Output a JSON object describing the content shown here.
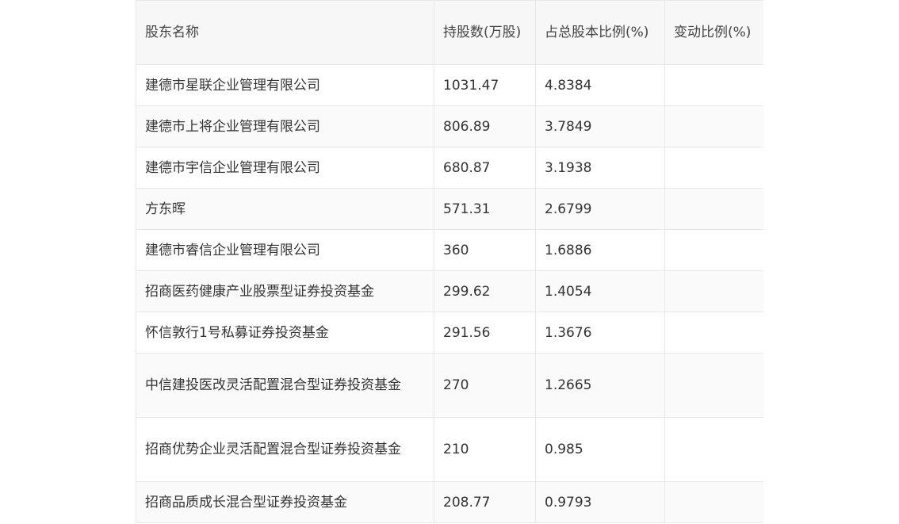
{
  "table": {
    "headers": [
      "股东名称",
      "持股数(万股)",
      "占总股本比例(%)",
      "变动比例(%)"
    ],
    "rows": [
      {
        "name": "建德市星联企业管理有限公司",
        "shares": "1031.47",
        "ratio": "4.8384",
        "change": ""
      },
      {
        "name": "建德市上将企业管理有限公司",
        "shares": "806.89",
        "ratio": "3.7849",
        "change": ""
      },
      {
        "name": "建德市宇信企业管理有限公司",
        "shares": "680.87",
        "ratio": "3.1938",
        "change": ""
      },
      {
        "name": "方东晖",
        "shares": "571.31",
        "ratio": "2.6799",
        "change": ""
      },
      {
        "name": "建德市睿信企业管理有限公司",
        "shares": "360",
        "ratio": "1.6886",
        "change": ""
      },
      {
        "name": "招商医药健康产业股票型证券投资基金",
        "shares": "299.62",
        "ratio": "1.4054",
        "change": ""
      },
      {
        "name": "怀信敦行1号私募证券投资基金",
        "shares": "291.56",
        "ratio": "1.3676",
        "change": ""
      },
      {
        "name": "中信建投医改灵活配置混合型证券投资基金",
        "shares": "270",
        "ratio": "1.2665",
        "change": ""
      },
      {
        "name": "招商优势企业灵活配置混合型证券投资基金",
        "shares": "210",
        "ratio": "0.985",
        "change": ""
      },
      {
        "name": "招商品质成长混合型证券投资基金",
        "shares": "208.77",
        "ratio": "0.9793",
        "change": ""
      }
    ]
  }
}
